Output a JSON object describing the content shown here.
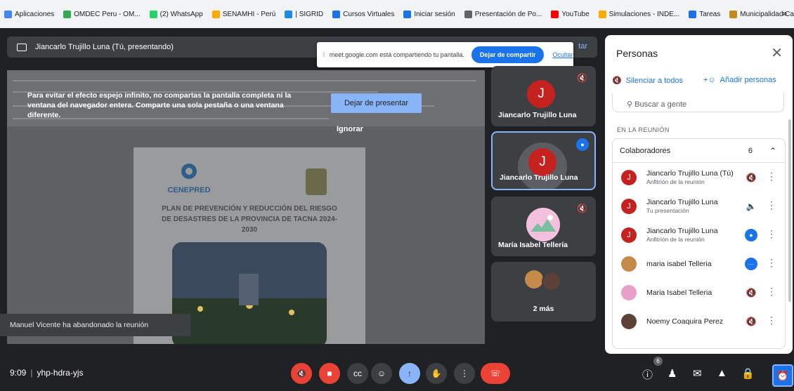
{
  "bookmarks": {
    "items": [
      {
        "label": "Aplicaciones",
        "color": "#4285f4"
      },
      {
        "label": "OMDEC Peru - OM...",
        "color": "#34a853"
      },
      {
        "label": "(2) WhatsApp",
        "color": "#25d366"
      },
      {
        "label": "SENAMHI - Perú",
        "color": "#f9ab00"
      },
      {
        "label": "| SIGRID",
        "color": "#1e88e5"
      },
      {
        "label": "Cursos Virtuales",
        "color": "#1a73e8"
      },
      {
        "label": "Iniciar sesión",
        "color": "#1a73e8"
      },
      {
        "label": "Presentación de Po...",
        "color": "#5f6368"
      },
      {
        "label": "YouTube",
        "color": "#ff0000"
      },
      {
        "label": "Simulaciones - INDE...",
        "color": "#f9ab00"
      },
      {
        "label": "Tareas",
        "color": "#1a73e8"
      },
      {
        "label": "Municipalidad Carm...",
        "color": "#c58a1b"
      }
    ],
    "more": "»"
  },
  "presenter_bar": {
    "title": "Jiancarlo Trujillo Luna (Tú, presentando)",
    "tail": "tar"
  },
  "share_notice": {
    "text": "meet.google.com está compartiendo tu pantalla.",
    "stop_button": "Dejar de compartir",
    "hide_link": "Ocultar"
  },
  "warning": {
    "text": "Para evitar el efecto espejo infinito, no compartas la pantalla completa ni la ventana del navegador entera. Comparte una sola pestaña o una ventana diferente.",
    "stop_presenting": "Dejar de presentar",
    "ignore": "Ignorar"
  },
  "document": {
    "logo_text": "CENEPRED",
    "title": "PLAN DE PREVENCIÓN Y REDUCCIÓN DEL RIESGO DE DESASTRES DE LA PROVINCIA DE TACNA 2024-2030"
  },
  "toast": "Manuel Vicente ha abandonado la reunión",
  "tiles": [
    {
      "name": "Jiancarlo Trujillo Luna",
      "initial": "J"
    },
    {
      "name": "Jiancarlo Trujillo Luna",
      "initial": "J"
    },
    {
      "name": "María Isabel Tellería"
    },
    {
      "name": "2 más"
    }
  ],
  "panel": {
    "title": "Personas",
    "mute_all": "Silenciar a todos",
    "add_people": "Añadir personas",
    "search_placeholder": "Buscar a gente",
    "section": "EN LA REUNIÓN",
    "group": "Colaboradores",
    "group_count": "6",
    "participants": [
      {
        "name": "Jiancarlo Trujillo Luna (Tú)",
        "sub": "Anfitrión de la reunión",
        "initial": "J",
        "color": "#c5221f"
      },
      {
        "name": "Jiancarlo Trujillo Luna",
        "sub": "Tu presentación",
        "initial": "J",
        "color": "#c5221f"
      },
      {
        "name": "Jiancarlo Trujillo Luna",
        "sub": "Anfitrión de la reunión",
        "initial": "J",
        "color": "#c5221f"
      },
      {
        "name": "maria isabel Telleria",
        "sub": "",
        "initial": "",
        "color": "#c58a4a"
      },
      {
        "name": "Maria Isabel Telleria",
        "sub": "",
        "initial": "",
        "color": "#e8a0c8"
      },
      {
        "name": "Noemy Coaquira Perez",
        "sub": "",
        "initial": "",
        "color": "#5d4037"
      }
    ]
  },
  "bottom": {
    "time": "9:09",
    "meeting_code": "yhp-hdra-yjs",
    "people_badge": "6"
  }
}
